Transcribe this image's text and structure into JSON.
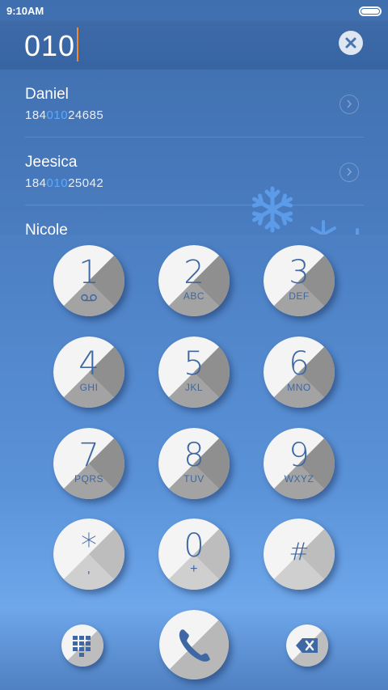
{
  "status_bar": {
    "time": "9:10AM"
  },
  "dial": {
    "number": "010"
  },
  "contacts": [
    {
      "name": "Daniel",
      "phone_pre": "184",
      "phone_match": "010",
      "phone_post": "24685"
    },
    {
      "name": "Jeesica",
      "phone_pre": "184",
      "phone_match": "010",
      "phone_post": "25042"
    },
    {
      "name": "Nicole",
      "phone_pre": "",
      "phone_match": "",
      "phone_post": ""
    }
  ],
  "keypad": [
    {
      "digit": "1",
      "letters": ""
    },
    {
      "digit": "2",
      "letters": "ABC"
    },
    {
      "digit": "3",
      "letters": "DEF"
    },
    {
      "digit": "4",
      "letters": "GHI"
    },
    {
      "digit": "5",
      "letters": "JKL"
    },
    {
      "digit": "6",
      "letters": "MNO"
    },
    {
      "digit": "7",
      "letters": "PQRS"
    },
    {
      "digit": "8",
      "letters": "TUV"
    },
    {
      "digit": "9",
      "letters": "WXYZ"
    },
    {
      "digit": "*",
      "letters": ","
    },
    {
      "digit": "0",
      "letters": "+"
    },
    {
      "digit": "#",
      "letters": ""
    }
  ],
  "icons": {
    "clear": "close-icon",
    "voicemail": "voicemail-icon",
    "keypad_toggle": "dialpad-icon",
    "call": "phone-icon",
    "backspace": "backspace-icon",
    "contact_detail": "chevron-right-icon",
    "decoration": "snowflake-icon"
  },
  "colors": {
    "accent_match": "#5aa9ff",
    "cursor": "#f58a2a",
    "key_text": "#3e67a3"
  }
}
